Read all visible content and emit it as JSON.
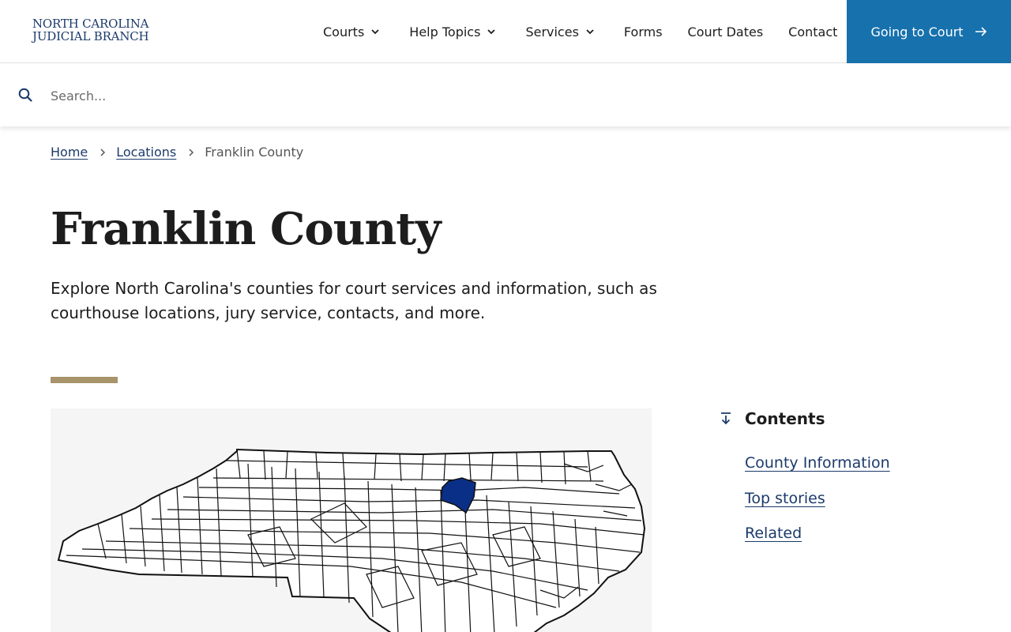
{
  "header": {
    "logo_line1": "NORTH CAROLINA",
    "logo_line2": "JUDICIAL BRANCH",
    "nav": [
      {
        "label": "Courts",
        "has_dropdown": true
      },
      {
        "label": "Help Topics",
        "has_dropdown": true
      },
      {
        "label": "Services",
        "has_dropdown": true
      },
      {
        "label": "Forms",
        "has_dropdown": false
      },
      {
        "label": "Court Dates",
        "has_dropdown": false
      },
      {
        "label": "Contact",
        "has_dropdown": false
      }
    ],
    "cta_label": "Going to Court",
    "cta_color": "#1771ad"
  },
  "search": {
    "placeholder": "Search...",
    "value": ""
  },
  "breadcrumb": {
    "home": "Home",
    "locations": "Locations",
    "current": "Franklin County"
  },
  "page": {
    "title": "Franklin County",
    "lead": "Explore North Carolina's counties for court services and information, such as courthouse locations, jury service, contacts, and more.",
    "accent_color": "#a8946b"
  },
  "map": {
    "highlight_color": "#0a2f86",
    "highlighted_county": "Franklin"
  },
  "contents": {
    "heading": "Contents",
    "items": [
      "County Information",
      "Top stories",
      "Related"
    ]
  },
  "icons": {
    "search": "search-icon",
    "chevron": "chevron-down-icon",
    "arrow": "arrow-right-icon",
    "contents": "arrow-down-to-line-icon",
    "breadcrumb_sep": "chevron-right-icon"
  }
}
